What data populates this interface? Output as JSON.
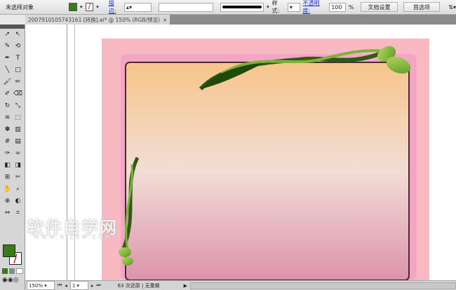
{
  "control_bar": {
    "selection": "未选择对象",
    "stroke_label": "描边:",
    "style_label": "样式:",
    "opacity_label": "不透明度:",
    "opacity_value": "100",
    "opacity_unit": "%",
    "doc_setup": "文档设置",
    "preferences": "首选项"
  },
  "document_tab": {
    "title": "2007910105743161 [转换].ai* @ 150% (RGB/预览)",
    "close": "×"
  },
  "colors": {
    "fill": "#3a7a1a",
    "frame_top": "#f7c58a",
    "frame_bottom": "#dc93ac",
    "artboard": "#f9b9c3"
  },
  "watermark": {
    "text": "软件自学网",
    "url": "WWW.RJZXW.COM"
  },
  "status": {
    "zoom": "150%",
    "page": "1",
    "message": "63 次还原 | 无重做"
  }
}
